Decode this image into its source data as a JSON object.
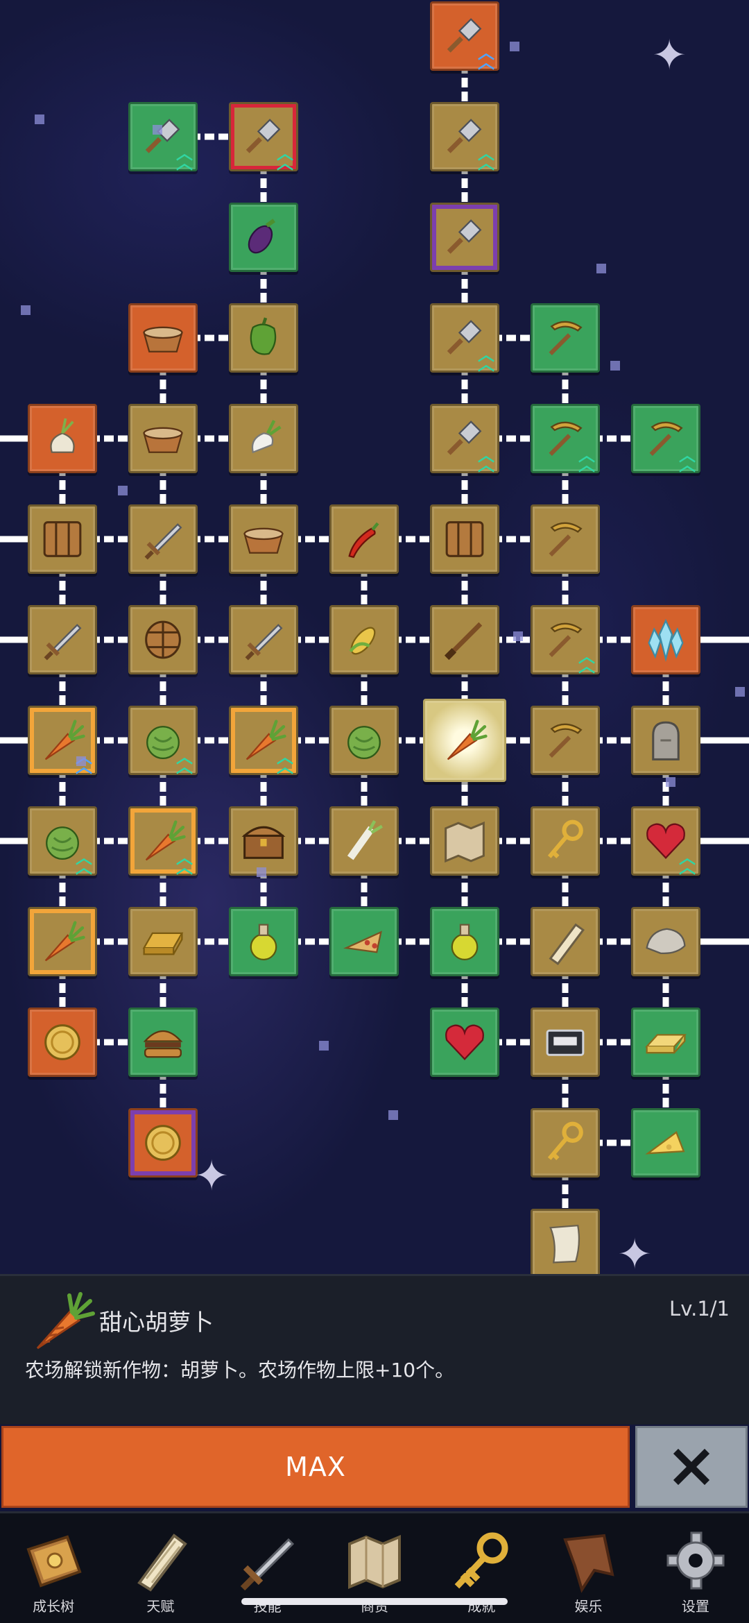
{
  "info_panel": {
    "item_name": "甜心胡萝卜",
    "level": "Lv.1/1",
    "description": "农场解锁新作物：胡萝卜。农场作物上限+10个。"
  },
  "buttons": {
    "max_label": "MAX",
    "close_icon": "close-x-icon"
  },
  "nav": {
    "items": [
      {
        "label": "成长树",
        "icon": "book-icon"
      },
      {
        "label": "天赋",
        "icon": "scroll-icon"
      },
      {
        "label": "技能",
        "icon": "sword-icon"
      },
      {
        "label": "商贸",
        "icon": "map-icon"
      },
      {
        "label": "成就",
        "icon": "key-icon"
      },
      {
        "label": "娱乐",
        "icon": "banner-icon"
      },
      {
        "label": "设置",
        "icon": "gear-icon"
      }
    ]
  },
  "skill_tree": {
    "selected_node": "carrot",
    "nodes": [
      {
        "icon": "shovel",
        "state": "orange",
        "upgrade": "blue"
      },
      {
        "icon": "shovel",
        "state": "green",
        "upgrade": "green"
      },
      {
        "icon": "shovel",
        "state": "owned",
        "upgrade": "green",
        "frame": "red"
      },
      {
        "icon": "shovel",
        "state": "owned",
        "upgrade": "green"
      },
      {
        "icon": "eggplant",
        "state": "green"
      },
      {
        "icon": "shovel",
        "state": "owned",
        "frame": "purple"
      },
      {
        "icon": "bowl",
        "state": "orange"
      },
      {
        "icon": "pepper",
        "state": "owned"
      },
      {
        "icon": "shovel",
        "state": "owned",
        "upgrade": "green"
      },
      {
        "icon": "pickaxe",
        "state": "green"
      },
      {
        "icon": "garlic",
        "state": "orange"
      },
      {
        "icon": "bowl",
        "state": "owned"
      },
      {
        "icon": "radish",
        "state": "owned"
      },
      {
        "icon": "shovel",
        "state": "owned",
        "upgrade": "green"
      },
      {
        "icon": "pickaxe",
        "state": "green",
        "upgrade": "green"
      },
      {
        "icon": "pickaxe",
        "state": "green",
        "upgrade": "green"
      },
      {
        "icon": "crate",
        "state": "owned"
      },
      {
        "icon": "sword",
        "state": "owned"
      },
      {
        "icon": "bowl",
        "state": "owned"
      },
      {
        "icon": "chili",
        "state": "owned"
      },
      {
        "icon": "crate",
        "state": "owned"
      },
      {
        "icon": "pickaxe",
        "state": "owned"
      },
      {
        "icon": "sword",
        "state": "owned"
      },
      {
        "icon": "barrel",
        "state": "owned"
      },
      {
        "icon": "sword",
        "state": "owned"
      },
      {
        "icon": "corn",
        "state": "owned"
      },
      {
        "icon": "rifle",
        "state": "owned"
      },
      {
        "icon": "pickaxe",
        "state": "owned",
        "upgrade": "green"
      },
      {
        "icon": "crystal",
        "state": "orange"
      },
      {
        "icon": "carrot",
        "state": "owned",
        "frame": "gold",
        "upgrade": "blue"
      },
      {
        "icon": "cabbage",
        "state": "owned",
        "upgrade": "green"
      },
      {
        "icon": "carrot",
        "state": "owned",
        "frame": "gold",
        "upgrade": "green"
      },
      {
        "icon": "cabbage",
        "state": "owned"
      },
      {
        "icon": "carrot",
        "state": "selected"
      },
      {
        "icon": "pickaxe",
        "state": "owned"
      },
      {
        "icon": "tombstone",
        "state": "owned"
      },
      {
        "icon": "cabbage",
        "state": "owned",
        "upgrade": "green"
      },
      {
        "icon": "carrot",
        "state": "owned",
        "frame": "gold",
        "upgrade": "green"
      },
      {
        "icon": "chest",
        "state": "owned"
      },
      {
        "icon": "leek",
        "state": "owned"
      },
      {
        "icon": "map",
        "state": "owned"
      },
      {
        "icon": "key",
        "state": "owned"
      },
      {
        "icon": "heart",
        "state": "owned",
        "upgrade": "green"
      },
      {
        "icon": "carrot",
        "state": "owned",
        "frame": "gold"
      },
      {
        "icon": "gold-bar",
        "state": "owned"
      },
      {
        "icon": "potion",
        "state": "green"
      },
      {
        "icon": "pizza",
        "state": "green"
      },
      {
        "icon": "potion",
        "state": "green"
      },
      {
        "icon": "scroll",
        "state": "owned"
      },
      {
        "icon": "rock",
        "state": "owned"
      },
      {
        "icon": "coin",
        "state": "orange"
      },
      {
        "icon": "burger",
        "state": "green"
      },
      {
        "icon": "heart",
        "state": "green"
      },
      {
        "icon": "cassette",
        "state": "owned"
      },
      {
        "icon": "butter",
        "state": "green"
      },
      {
        "icon": "coin",
        "state": "orange",
        "frame": "purple"
      },
      {
        "icon": "key",
        "state": "owned"
      },
      {
        "icon": "cheese",
        "state": "green"
      },
      {
        "icon": "parchment",
        "state": "owned"
      },
      {
        "icon": "blob",
        "state": "locked"
      }
    ]
  }
}
